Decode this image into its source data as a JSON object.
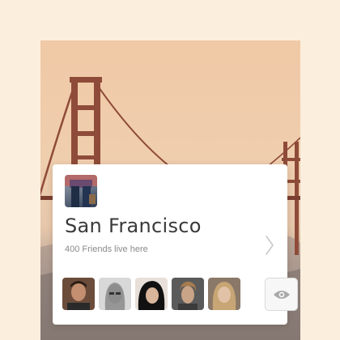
{
  "card": {
    "city": "San Francisco",
    "friends_text": "400 Friends live here"
  },
  "icons": {
    "chevron": "chevron-right-icon",
    "eye": "eye-icon"
  },
  "avatars": [
    {
      "label": "friend-1"
    },
    {
      "label": "friend-2"
    },
    {
      "label": "friend-3"
    },
    {
      "label": "friend-4"
    },
    {
      "label": "friend-5"
    }
  ],
  "colors": {
    "background": "#fbeedd",
    "card": "#ffffff",
    "title": "#3a3a3a",
    "subtitle": "#8a8a8a",
    "bridge": "#8f4b39"
  }
}
